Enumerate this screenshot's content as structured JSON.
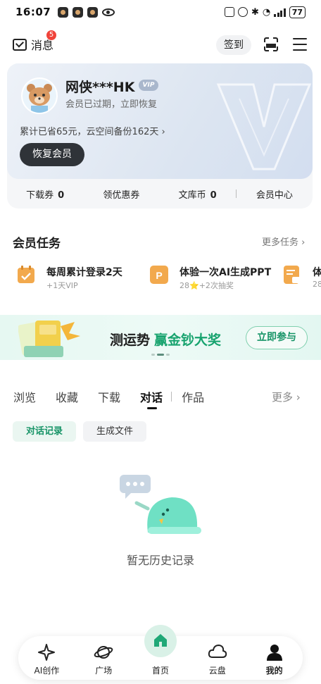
{
  "status_bar": {
    "time": "16:07",
    "battery": "77"
  },
  "header": {
    "messages_label": "消息",
    "messages_badge": "5",
    "checkin_label": "签到"
  },
  "member_card": {
    "user_name": "网侠***HK",
    "vip_tag": "VIP",
    "expire_text": "会员已过期，立即恢复",
    "savings_text": "累计已省65元，云空间备份162天 ›",
    "restore_button": "恢复会员",
    "stats": [
      {
        "label": "下载券",
        "value": "0"
      },
      {
        "label": "领优惠券",
        "value": ""
      },
      {
        "label": "文库币",
        "value": "0"
      },
      {
        "label": "会员中心",
        "value": ""
      }
    ]
  },
  "tasks": {
    "title": "会员任务",
    "more": "更多任务 ›",
    "items": [
      {
        "title": "每周累计登录2天",
        "sub": "+1天VIP",
        "icon": "calendar-check-icon"
      },
      {
        "title": "体验一次AI生成PPT",
        "sub": "28⭐+2次抽奖",
        "icon": "ppt-icon"
      },
      {
        "title": "体",
        "sub": "28",
        "icon": "document-image-icon"
      }
    ]
  },
  "banner": {
    "text": "测运势",
    "highlight": "赢金钞大奖",
    "button": "立即参与"
  },
  "tabs": {
    "items": [
      "浏览",
      "收藏",
      "下载",
      "对话",
      "作品"
    ],
    "active": "对话",
    "more": "更多 ›"
  },
  "subtabs": [
    "对话记录",
    "生成文件"
  ],
  "empty_state": {
    "text": "暂无历史记录"
  },
  "bottom_nav": [
    {
      "label": "AI创作",
      "icon": "sparkle-icon"
    },
    {
      "label": "广场",
      "icon": "planet-icon"
    },
    {
      "label": "首页",
      "icon": "home-icon"
    },
    {
      "label": "云盘",
      "icon": "cloud-icon"
    },
    {
      "label": "我的",
      "icon": "person-icon"
    }
  ],
  "colors": {
    "accent_green": "#17a36e",
    "badge_red": "#f0433a",
    "dark_button": "#2f3338"
  }
}
